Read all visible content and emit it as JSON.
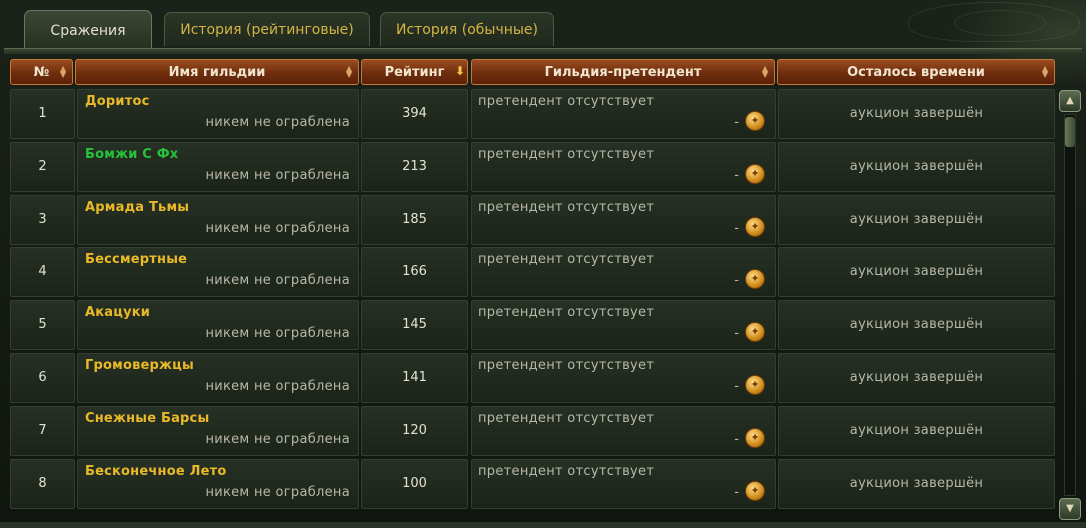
{
  "tabs": [
    {
      "label": "Сражения",
      "active": true
    },
    {
      "label": "История (рейтинговые)",
      "active": false
    },
    {
      "label": "История (обычные)",
      "active": false
    }
  ],
  "columns": {
    "num": "№",
    "name": "Имя гильдии",
    "rating": "Рейтинг",
    "challenger": "Гильдия-претендент",
    "time": "Осталось времени"
  },
  "colors": {
    "guild_default": "#e9b928",
    "guild_highlight": "#26c33a",
    "header_bg": "#7a330f"
  },
  "rows": [
    {
      "num": "1",
      "name": "Доритос",
      "name_color": "#e9b928",
      "status": "никем не ограблена",
      "rating": "394",
      "challenger": "претендент отсутствует",
      "dash": "-",
      "time": "аукцион завершён"
    },
    {
      "num": "2",
      "name": "Бомжи С Фх",
      "name_color": "#26c33a",
      "status": "никем не ограблена",
      "rating": "213",
      "challenger": "претендент отсутствует",
      "dash": "-",
      "time": "аукцион завершён"
    },
    {
      "num": "3",
      "name": "Армада Тьмы",
      "name_color": "#e9b928",
      "status": "никем не ограблена",
      "rating": "185",
      "challenger": "претендент отсутствует",
      "dash": "-",
      "time": "аукцион завершён"
    },
    {
      "num": "4",
      "name": "Бессмертные",
      "name_color": "#e9b928",
      "status": "никем не ограблена",
      "rating": "166",
      "challenger": "претендент отсутствует",
      "dash": "-",
      "time": "аукцион завершён"
    },
    {
      "num": "5",
      "name": "Акацуки",
      "name_color": "#e9b928",
      "status": "никем не ограблена",
      "rating": "145",
      "challenger": "претендент отсутствует",
      "dash": "-",
      "time": "аукцион завершён"
    },
    {
      "num": "6",
      "name": "Громовержцы",
      "name_color": "#e9b928",
      "status": "никем не ограблена",
      "rating": "141",
      "challenger": "претендент отсутствует",
      "dash": "-",
      "time": "аукцион завершён"
    },
    {
      "num": "7",
      "name": "Снежные Барсы",
      "name_color": "#e9b928",
      "status": "никем не ограблена",
      "rating": "120",
      "challenger": "претендент отсутствует",
      "dash": "-",
      "time": "аукцион завершён"
    },
    {
      "num": "8",
      "name": "Бесконечное Лето",
      "name_color": "#e9b928",
      "status": "никем не ограблена",
      "rating": "100",
      "challenger": "претендент отсутствует",
      "dash": "-",
      "time": "аукцион завершён"
    }
  ],
  "scrollbar": {
    "position": 0
  }
}
